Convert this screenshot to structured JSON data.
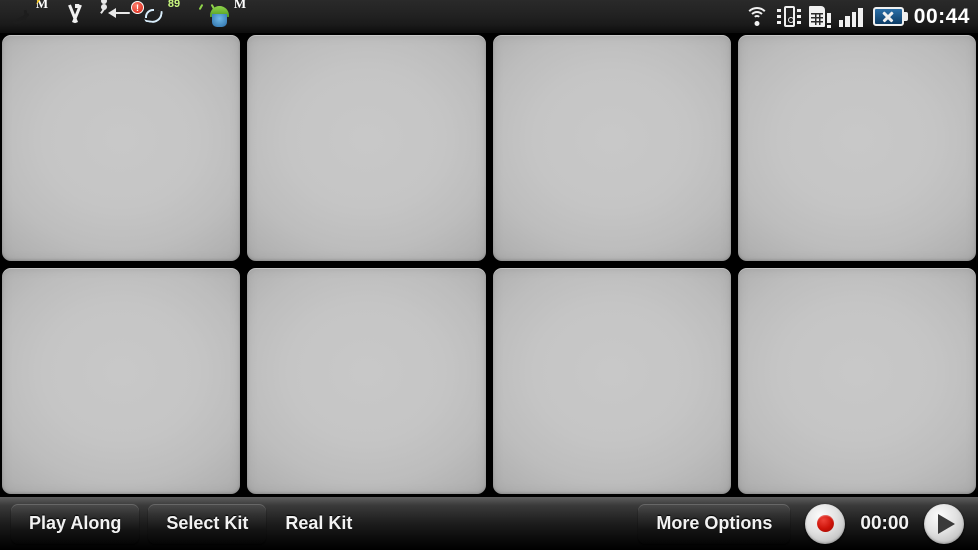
{
  "statusbar": {
    "left_icons": [
      {
        "name": "silent-mode-icon",
        "label": "silent-mode"
      },
      {
        "name": "mcafee-shield-charging-icon",
        "label": "M",
        "badge": "bolt"
      },
      {
        "name": "gmail-icon",
        "label": "M"
      },
      {
        "name": "usb-connected-icon",
        "label": "usb"
      },
      {
        "name": "sync-app-icon",
        "label": "sync",
        "badge": "!"
      },
      {
        "name": "battery-percent-ring-icon",
        "label": "89"
      },
      {
        "name": "android-system-icon",
        "label": "android"
      },
      {
        "name": "mcafee-shield-icon",
        "label": "M"
      }
    ],
    "right_icons": [
      {
        "name": "wifi-icon"
      },
      {
        "name": "vibrate-icon"
      },
      {
        "name": "sim-card-alert-icon"
      },
      {
        "name": "cellular-signal-icon"
      },
      {
        "name": "battery-no-charge-icon"
      }
    ],
    "clock": "00:44"
  },
  "pads": {
    "count": 8,
    "rows": 2,
    "columns": 4,
    "items": [
      {
        "index": 1,
        "label": ""
      },
      {
        "index": 2,
        "label": ""
      },
      {
        "index": 3,
        "label": ""
      },
      {
        "index": 4,
        "label": ""
      },
      {
        "index": 5,
        "label": ""
      },
      {
        "index": 6,
        "label": ""
      },
      {
        "index": 7,
        "label": ""
      },
      {
        "index": 8,
        "label": ""
      }
    ]
  },
  "toolbar": {
    "play_along_label": "Play Along",
    "select_kit_label": "Select Kit",
    "real_kit_label": "Real Kit",
    "more_options_label": "More Options",
    "record_label": "record-button",
    "timer": "00:00",
    "play_label": "play-button"
  },
  "colors": {
    "pad_face": "#c5c5c5",
    "pad_edge": "#a9a9a9",
    "background": "#000000",
    "record_red": "#cc1208",
    "status_text": "#ffffff"
  }
}
